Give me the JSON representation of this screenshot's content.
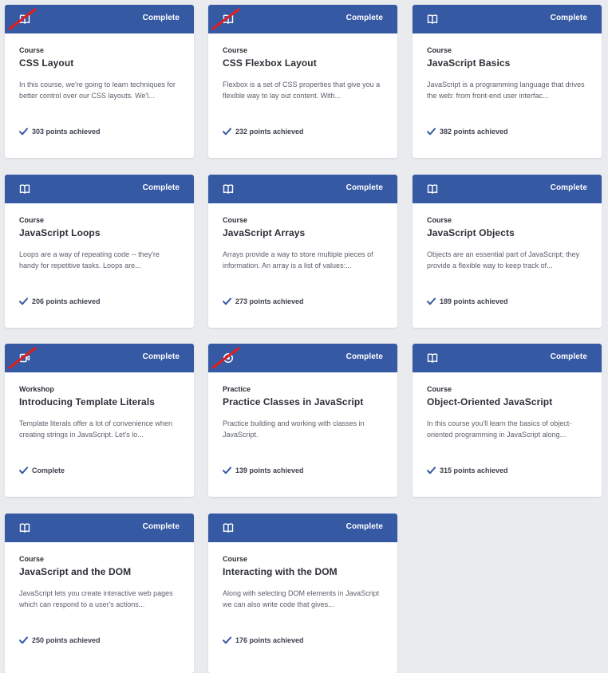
{
  "colors": {
    "header": "#3659a3",
    "accent_check": "#3659a3",
    "annotation_red": "#e02020",
    "background": "#e9ebef"
  },
  "cards": [
    {
      "type_label": "Course",
      "title": "CSS Layout",
      "description": "In this course, we're going to learn techniques for better control over our CSS layouts. We'l...",
      "status": "Complete",
      "achievement": "303 points achieved",
      "icon": "book-icon",
      "struck": true
    },
    {
      "type_label": "Course",
      "title": "CSS Flexbox Layout",
      "description": "Flexbox is a set of CSS properties that give you a flexible way to lay out content. With...",
      "status": "Complete",
      "achievement": "232 points achieved",
      "icon": "book-icon",
      "struck": true
    },
    {
      "type_label": "Course",
      "title": "JavaScript Basics",
      "description": "JavaScript is a programming language that drives the web: from front-end user interfac...",
      "status": "Complete",
      "achievement": "382 points achieved",
      "icon": "book-icon",
      "struck": false
    },
    {
      "type_label": "Course",
      "title": "JavaScript Loops",
      "description": "Loops are a way of repeating code -- they're handy for repetitive tasks. Loops are...",
      "status": "Complete",
      "achievement": "206 points achieved",
      "icon": "book-icon",
      "struck": false
    },
    {
      "type_label": "Course",
      "title": "JavaScript Arrays",
      "description": "Arrays provide a way to store multiple pieces of information. An array is a list of values:...",
      "status": "Complete",
      "achievement": "273 points achieved",
      "icon": "book-icon",
      "struck": false
    },
    {
      "type_label": "Course",
      "title": "JavaScript Objects",
      "description": "Objects are an essential part of JavaScript; they provide a flexible way to keep track of...",
      "status": "Complete",
      "achievement": "189 points achieved",
      "icon": "book-icon",
      "struck": false
    },
    {
      "type_label": "Workshop",
      "title": "Introducing Template Literals",
      "description": "Template literals offer a lot of convenience when creating strings in JavaScript. Let's lo...",
      "status": "Complete",
      "achievement": "Complete",
      "icon": "video-icon",
      "struck": true
    },
    {
      "type_label": "Practice",
      "title": "Practice Classes in JavaScript",
      "description": "Practice building and working with classes in JavaScript.",
      "status": "Complete",
      "achievement": "139 points achieved",
      "icon": "practice-icon",
      "struck": true
    },
    {
      "type_label": "Course",
      "title": "Object-Oriented JavaScript",
      "description": "In this course you'll learn the basics of object-oriented programming in JavaScript along...",
      "status": "Complete",
      "achievement": "315 points achieved",
      "icon": "book-icon",
      "struck": false
    },
    {
      "type_label": "Course",
      "title": "JavaScript and the DOM",
      "description": "JavaScript lets you create interactive web pages which can respond to a user's actions...",
      "status": "Complete",
      "achievement": "250 points achieved",
      "icon": "book-icon",
      "struck": false
    },
    {
      "type_label": "Course",
      "title": "Interacting with the DOM",
      "description": "Along with selecting DOM elements in JavaScript we can also write code that gives...",
      "status": "Complete",
      "achievement": "176 points achieved",
      "icon": "book-icon",
      "struck": false
    }
  ]
}
